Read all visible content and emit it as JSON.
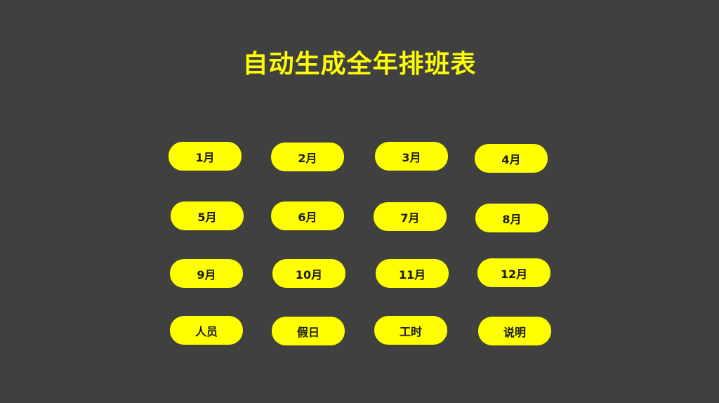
{
  "title": "自动生成全年排班表",
  "buttons": [
    {
      "label": "1月"
    },
    {
      "label": "2月"
    },
    {
      "label": "3月"
    },
    {
      "label": "4月"
    },
    {
      "label": "5月"
    },
    {
      "label": "6月"
    },
    {
      "label": "7月"
    },
    {
      "label": "8月"
    },
    {
      "label": "9月"
    },
    {
      "label": "10月"
    },
    {
      "label": "11月"
    },
    {
      "label": "12月"
    },
    {
      "label": "人员"
    },
    {
      "label": "假日"
    },
    {
      "label": "工时"
    },
    {
      "label": "说明"
    }
  ],
  "colors": {
    "background": "#404040",
    "accent": "#FFFF00",
    "button_text": "#1a1a1a"
  }
}
